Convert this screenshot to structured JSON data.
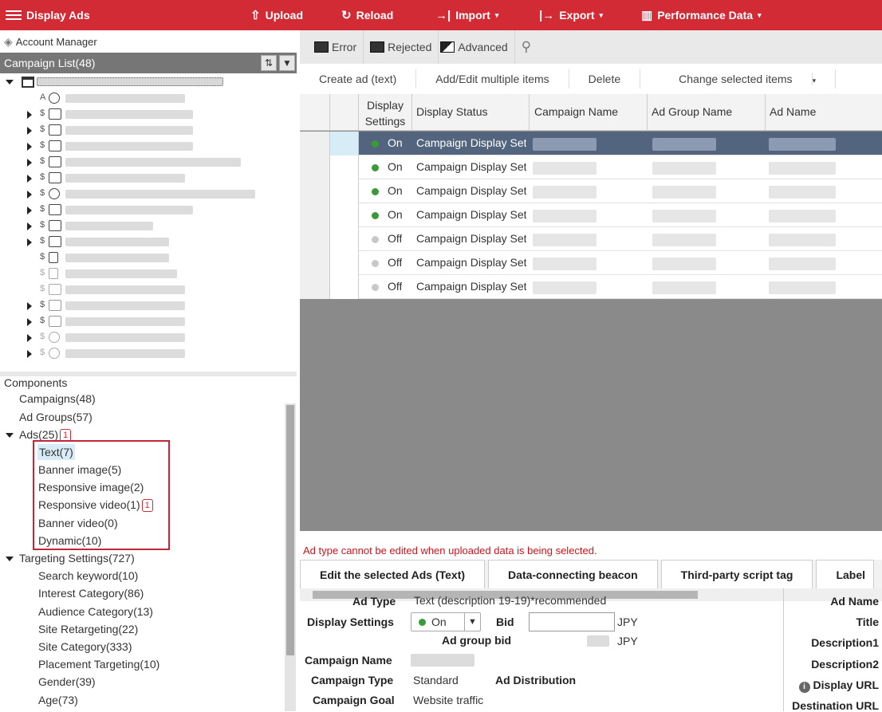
{
  "topbar": {
    "app_title": "Display Ads",
    "upload": "Upload",
    "reload": "Reload",
    "import": "Import",
    "export": "Export",
    "performance": "Performance Data"
  },
  "left": {
    "account_manager": "Account Manager",
    "campaign_list": "Campaign List(48)",
    "components_title": "Components",
    "components": [
      {
        "label": "Campaigns(48)"
      },
      {
        "label": "Ad Groups(57)"
      },
      {
        "label": "Ads(25)",
        "badge": "1"
      },
      {
        "label": "Text(7)"
      },
      {
        "label": "Banner image(5)"
      },
      {
        "label": "Responsive image(2)"
      },
      {
        "label": "Responsive video(1)",
        "badge": "1"
      },
      {
        "label": "Banner video(0)"
      },
      {
        "label": "Dynamic(10)"
      },
      {
        "label": "Targeting Settings(727)"
      },
      {
        "label": "Search keyword(10)"
      },
      {
        "label": "Interest Category(86)"
      },
      {
        "label": "Audience Category(13)"
      },
      {
        "label": "Site Retargeting(22)"
      },
      {
        "label": "Site Category(333)"
      },
      {
        "label": "Placement Targeting(10)"
      },
      {
        "label": "Gender(39)"
      },
      {
        "label": "Age(73)"
      }
    ]
  },
  "filters": {
    "error": "Error",
    "rejected": "Rejected",
    "advanced": "Advanced"
  },
  "actions": {
    "create_ad": "Create ad (text)",
    "add_edit": "Add/Edit multiple items",
    "delete": "Delete",
    "change": "Change selected items"
  },
  "grid": {
    "headers": {
      "display_settings_1": "Display",
      "display_settings_2": "Settings",
      "display_status": "Display Status",
      "campaign_name": "Campaign Name",
      "ad_group_name": "Ad Group Name",
      "ad_name": "Ad Name"
    },
    "rows": [
      {
        "setting": "On",
        "status": "Campaign Display Set"
      },
      {
        "setting": "On",
        "status": "Campaign Display Set"
      },
      {
        "setting": "On",
        "status": "Campaign Display Set"
      },
      {
        "setting": "On",
        "status": "Campaign Display Set"
      },
      {
        "setting": "Off",
        "status": "Campaign Display Set"
      },
      {
        "setting": "Off",
        "status": "Campaign Display Set"
      },
      {
        "setting": "Off",
        "status": "Campaign Display Set"
      }
    ],
    "colors": {
      "on": "#3a9a3a",
      "off": "#c8c8c8",
      "selected_row": "#53647f"
    }
  },
  "warning": "Ad type cannot be edited when uploaded data is being selected.",
  "bottom_tabs": {
    "edit": "Edit the selected Ads (Text)",
    "beacon": "Data-connecting beacon",
    "script": "Third-party script tag",
    "label": "Label"
  },
  "form": {
    "ad_type_label": "Ad Type",
    "ad_type_value": "Text (description 19-19)*recommended",
    "display_settings_label": "Display Settings",
    "display_settings_value": "On",
    "bid_label": "Bid",
    "bid_unit": "JPY",
    "ad_group_bid_label": "Ad group bid",
    "ad_group_bid_unit": "JPY",
    "campaign_name_label": "Campaign Name",
    "campaign_type_label": "Campaign Type",
    "campaign_type_value": "Standard",
    "ad_distribution_label": "Ad Distribution",
    "campaign_goal_label": "Campaign Goal",
    "campaign_goal_value": "Website traffic",
    "right_labels": {
      "ad_name": "Ad Name",
      "title": "Title",
      "description1": "Description1",
      "description2": "Description2",
      "display_url": "Display URL",
      "destination_url": "Destination URL"
    }
  },
  "brand_color": "#d22b35"
}
